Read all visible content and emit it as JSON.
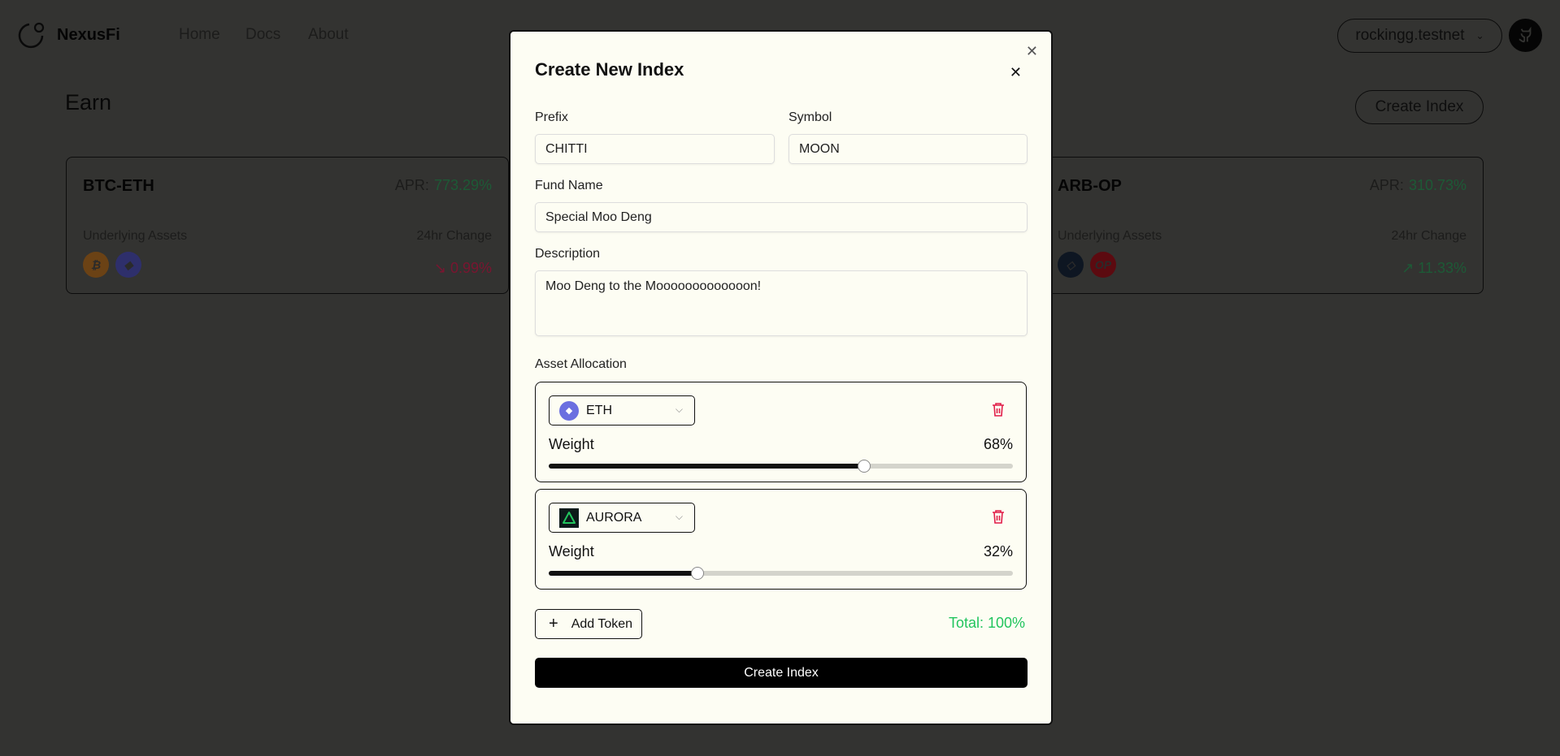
{
  "header": {
    "brand": "NexusFi",
    "nav": [
      "Home",
      "Docs",
      "About"
    ],
    "wallet": "rockingg.testnet"
  },
  "page": {
    "title": "Earn",
    "create_button": "Create Index"
  },
  "cards": [
    {
      "title": "BTC-ETH",
      "apr_label": "APR:",
      "apr": "773.29%",
      "assets_label": "Underlying Assets",
      "change_label": "24hr Change",
      "change": "0.99%",
      "direction": "down",
      "coins": [
        "BTC",
        "ETH"
      ]
    },
    {
      "title": "ARB-OP",
      "apr_label": "APR:",
      "apr": "310.73%",
      "assets_label": "Underlying Assets",
      "change_label": "24hr Change",
      "change": "11.33%",
      "direction": "up",
      "coins": [
        "ARB",
        "OP"
      ]
    }
  ],
  "modal": {
    "title": "Create New Index",
    "prefix_label": "Prefix",
    "prefix_value": "CHITTI",
    "symbol_label": "Symbol",
    "symbol_value": "MOON",
    "fund_label": "Fund Name",
    "fund_value": "Special Moo Deng",
    "desc_label": "Description",
    "desc_value": "Moo Deng to the Mooooooooooooon!",
    "alloc_label": "Asset Allocation",
    "allocations": [
      {
        "token": "ETH",
        "weight_label": "Weight",
        "weight": 68,
        "weight_text": "68%"
      },
      {
        "token": "AURORA",
        "weight_label": "Weight",
        "weight": 32,
        "weight_text": "32%"
      }
    ],
    "add_token": "Add Token",
    "total": "Total: 100%",
    "submit": "Create Index"
  },
  "colors": {
    "accent_green": "#22c55e",
    "danger": "#e11d48",
    "eth": "#6b6fe0",
    "btc": "#f7931a"
  }
}
